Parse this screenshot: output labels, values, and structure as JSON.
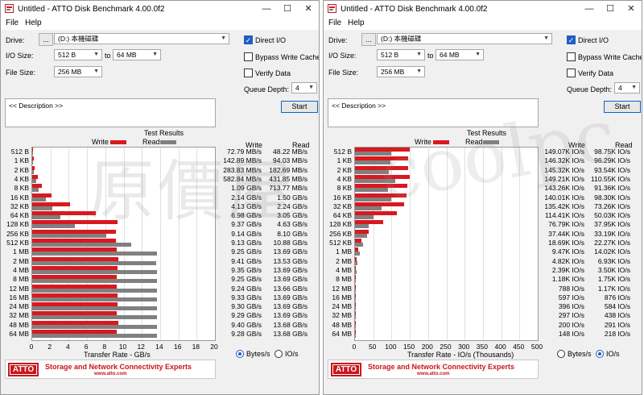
{
  "windows": [
    {
      "title": "Untitled - ATTO Disk Benchmark 4.00.0f2",
      "menu": [
        "File",
        "Help"
      ],
      "drive_label": "Drive:",
      "browse_label": "...",
      "drive_value": "(D:) 本機磁碟",
      "io_size_label": "I/O Size:",
      "io_from": "512 B",
      "io_to_label": "to",
      "io_to": "64 MB",
      "file_size_label": "File Size:",
      "file_size": "256 MB",
      "direct_io_label": "Direct I/O",
      "direct_io": true,
      "bypass_label": "Bypass Write Cache",
      "bypass": false,
      "verify_label": "Verify Data",
      "verify": false,
      "queue_label": "Queue Depth:",
      "queue_depth": "4",
      "description": "<< Description >>",
      "start_label": "Start",
      "results_title": "Test Results",
      "legend_write": "Write",
      "legend_read": "Read",
      "col_write": "Write",
      "col_read": "Read",
      "x_axis_label": "Transfer Rate - GB/s",
      "x_ticks": [
        "0",
        "2",
        "4",
        "6",
        "8",
        "10",
        "12",
        "14",
        "16",
        "18",
        "20"
      ],
      "radio_bytes": "Bytes/s",
      "radio_io": "IO/s",
      "mode": "bytes",
      "banner_logo": "ATTO",
      "banner_text": "Storage and Network Connectivity Experts",
      "banner_url": "www.atto.com",
      "rows": [
        {
          "size": "512 B",
          "write": "72.79 MB/s",
          "read": "48.22 MB/s"
        },
        {
          "size": "1 KB",
          "write": "142.89 MB/s",
          "read": "94.03 MB/s"
        },
        {
          "size": "2 KB",
          "write": "283.83 MB/s",
          "read": "182.69 MB/s"
        },
        {
          "size": "4 KB",
          "write": "582.84 MB/s",
          "read": "431.85 MB/s"
        },
        {
          "size": "8 KB",
          "write": "1.09 GB/s",
          "read": "713.77 MB/s"
        },
        {
          "size": "16 KB",
          "write": "2.14 GB/s",
          "read": "1.50 GB/s"
        },
        {
          "size": "32 KB",
          "write": "4.13 GB/s",
          "read": "2.24 GB/s"
        },
        {
          "size": "64 KB",
          "write": "6.98 GB/s",
          "read": "3.05 GB/s"
        },
        {
          "size": "128 KB",
          "write": "9.37 GB/s",
          "read": "4.63 GB/s"
        },
        {
          "size": "256 KB",
          "write": "9.14 GB/s",
          "read": "8.10 GB/s"
        },
        {
          "size": "512 KB",
          "write": "9.13 GB/s",
          "read": "10.88 GB/s"
        },
        {
          "size": "1 MB",
          "write": "9.25 GB/s",
          "read": "13.69 GB/s"
        },
        {
          "size": "2 MB",
          "write": "9.41 GB/s",
          "read": "13.53 GB/s"
        },
        {
          "size": "4 MB",
          "write": "9.35 GB/s",
          "read": "13.69 GB/s"
        },
        {
          "size": "8 MB",
          "write": "9.25 GB/s",
          "read": "13.69 GB/s"
        },
        {
          "size": "12 MB",
          "write": "9.24 GB/s",
          "read": "13.66 GB/s"
        },
        {
          "size": "16 MB",
          "write": "9.33 GB/s",
          "read": "13.69 GB/s"
        },
        {
          "size": "24 MB",
          "write": "9.30 GB/s",
          "read": "13.69 GB/s"
        },
        {
          "size": "32 MB",
          "write": "9.29 GB/s",
          "read": "13.69 GB/s"
        },
        {
          "size": "48 MB",
          "write": "9.40 GB/s",
          "read": "13.68 GB/s"
        },
        {
          "size": "64 MB",
          "write": "9.28 GB/s",
          "read": "13.68 GB/s"
        }
      ],
      "chart_data": {
        "type": "bar",
        "unit": "GB/s",
        "xlabel": "Transfer Rate - GB/s",
        "xlim": [
          0,
          20
        ],
        "categories": [
          "512 B",
          "1 KB",
          "2 KB",
          "4 KB",
          "8 KB",
          "16 KB",
          "32 KB",
          "64 KB",
          "128 KB",
          "256 KB",
          "512 KB",
          "1 MB",
          "2 MB",
          "4 MB",
          "8 MB",
          "12 MB",
          "16 MB",
          "24 MB",
          "32 MB",
          "48 MB",
          "64 MB"
        ],
        "series": [
          {
            "name": "Write",
            "color": "#d8191f",
            "values": [
              0.07279,
              0.14289,
              0.28383,
              0.58284,
              1.09,
              2.14,
              4.13,
              6.98,
              9.37,
              9.14,
              9.13,
              9.25,
              9.41,
              9.35,
              9.25,
              9.24,
              9.33,
              9.3,
              9.29,
              9.4,
              9.28
            ]
          },
          {
            "name": "Read",
            "color": "#808080",
            "values": [
              0.04822,
              0.09403,
              0.18269,
              0.43185,
              0.71377,
              1.5,
              2.24,
              3.05,
              4.63,
              8.1,
              10.88,
              13.69,
              13.53,
              13.69,
              13.69,
              13.66,
              13.69,
              13.69,
              13.69,
              13.68,
              13.68
            ]
          }
        ]
      }
    },
    {
      "title": "Untitled - ATTO Disk Benchmark 4.00.0f2",
      "menu": [
        "File",
        "Help"
      ],
      "drive_label": "Drive:",
      "browse_label": "...",
      "drive_value": "(D:) 本機磁碟",
      "io_size_label": "I/O Size:",
      "io_from": "512 B",
      "io_to_label": "to",
      "io_to": "64 MB",
      "file_size_label": "File Size:",
      "file_size": "256 MB",
      "direct_io_label": "Direct I/O",
      "direct_io": true,
      "bypass_label": "Bypass Write Cache",
      "bypass": false,
      "verify_label": "Verify Data",
      "verify": false,
      "queue_label": "Queue Depth:",
      "queue_depth": "4",
      "description": "<< Description >>",
      "start_label": "Start",
      "results_title": "Test Results",
      "legend_write": "Write",
      "legend_read": "Read",
      "col_write": "Write",
      "col_read": "Read",
      "x_axis_label": "Transfer Rate - IO/s (Thousands)",
      "x_ticks": [
        "0",
        "50",
        "100",
        "150",
        "200",
        "250",
        "300",
        "350",
        "400",
        "450",
        "500"
      ],
      "radio_bytes": "Bytes/s",
      "radio_io": "IO/s",
      "mode": "io",
      "banner_logo": "ATTO",
      "banner_text": "Storage and Network Connectivity Experts",
      "banner_url": "www.atto.com",
      "rows": [
        {
          "size": "512 B",
          "write": "149.07K IO/s",
          "read": "98.75K IO/s"
        },
        {
          "size": "1 KB",
          "write": "146.32K IO/s",
          "read": "96.29K IO/s"
        },
        {
          "size": "2 KB",
          "write": "145.32K IO/s",
          "read": "93.54K IO/s"
        },
        {
          "size": "4 KB",
          "write": "149.21K IO/s",
          "read": "110.55K IO/s"
        },
        {
          "size": "8 KB",
          "write": "143.26K IO/s",
          "read": "91.36K IO/s"
        },
        {
          "size": "16 KB",
          "write": "140.01K IO/s",
          "read": "98.30K IO/s"
        },
        {
          "size": "32 KB",
          "write": "135.42K IO/s",
          "read": "73.26K IO/s"
        },
        {
          "size": "64 KB",
          "write": "114.41K IO/s",
          "read": "50.03K IO/s"
        },
        {
          "size": "128 KB",
          "write": "76.79K IO/s",
          "read": "37.95K IO/s"
        },
        {
          "size": "256 KB",
          "write": "37.44K IO/s",
          "read": "33.19K IO/s"
        },
        {
          "size": "512 KB",
          "write": "18.69K IO/s",
          "read": "22.27K IO/s"
        },
        {
          "size": "1 MB",
          "write": "9.47K IO/s",
          "read": "14.02K IO/s"
        },
        {
          "size": "2 MB",
          "write": "4.82K IO/s",
          "read": "6.93K IO/s"
        },
        {
          "size": "4 MB",
          "write": "2.39K IO/s",
          "read": "3.50K IO/s"
        },
        {
          "size": "8 MB",
          "write": "1.18K IO/s",
          "read": "1.75K IO/s"
        },
        {
          "size": "12 MB",
          "write": "788 IO/s",
          "read": "1.17K IO/s"
        },
        {
          "size": "16 MB",
          "write": "597 IO/s",
          "read": "876 IO/s"
        },
        {
          "size": "24 MB",
          "write": "396 IO/s",
          "read": "584 IO/s"
        },
        {
          "size": "32 MB",
          "write": "297 IO/s",
          "read": "438 IO/s"
        },
        {
          "size": "48 MB",
          "write": "200 IO/s",
          "read": "291 IO/s"
        },
        {
          "size": "64 MB",
          "write": "148 IO/s",
          "read": "218 IO/s"
        }
      ],
      "chart_data": {
        "type": "bar",
        "unit": "K IO/s",
        "xlabel": "Transfer Rate - IO/s (Thousands)",
        "xlim": [
          0,
          500
        ],
        "categories": [
          "512 B",
          "1 KB",
          "2 KB",
          "4 KB",
          "8 KB",
          "16 KB",
          "32 KB",
          "64 KB",
          "128 KB",
          "256 KB",
          "512 KB",
          "1 MB",
          "2 MB",
          "4 MB",
          "8 MB",
          "12 MB",
          "16 MB",
          "24 MB",
          "32 MB",
          "48 MB",
          "64 MB"
        ],
        "series": [
          {
            "name": "Write",
            "color": "#d8191f",
            "values": [
              149.07,
              146.32,
              145.32,
              149.21,
              143.26,
              140.01,
              135.42,
              114.41,
              76.79,
              37.44,
              18.69,
              9.47,
              4.82,
              2.39,
              1.18,
              0.788,
              0.597,
              0.396,
              0.297,
              0.2,
              0.148
            ]
          },
          {
            "name": "Read",
            "color": "#808080",
            "values": [
              98.75,
              96.29,
              93.54,
              110.55,
              91.36,
              98.3,
              73.26,
              50.03,
              37.95,
              33.19,
              22.27,
              14.02,
              6.93,
              3.5,
              1.75,
              1.17,
              0.876,
              0.584,
              0.438,
              0.291,
              0.218
            ]
          }
        ]
      }
    }
  ],
  "watermark": "原價屋coolpc"
}
